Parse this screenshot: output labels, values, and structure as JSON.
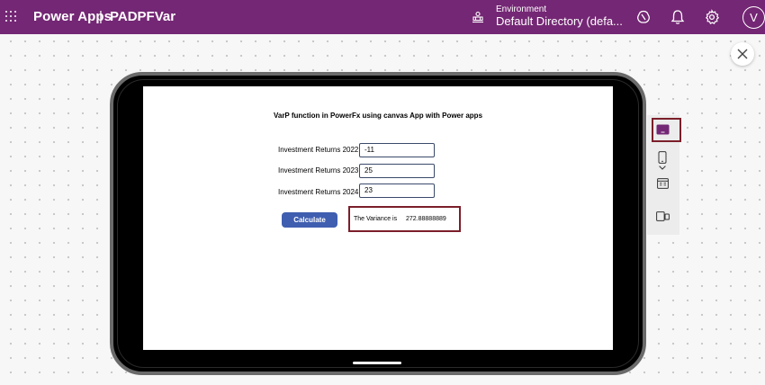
{
  "header": {
    "app_name": "Power Apps",
    "separator": "|",
    "file_name": "PADPFVar",
    "environment_label": "Environment",
    "environment_value": "Default Directory (defa...",
    "user_initial": "V"
  },
  "app": {
    "title": "VarP function in PowerFx using canvas App with Power apps",
    "fields": [
      {
        "label": "Investment Returns 2022",
        "value": "-11"
      },
      {
        "label": "Investment Returns 2023",
        "value": "25"
      },
      {
        "label": "Investment Returns 2024",
        "value": "23"
      }
    ],
    "calculate_label": "Calculate",
    "result_label": "The Variance is",
    "result_value": "272.88888889"
  },
  "colors": {
    "brand": "#742774",
    "button": "#3f5eb0",
    "highlight": "#7b1f2a"
  },
  "icons": [
    "waffle-icon",
    "environment-icon",
    "copilot-icon",
    "bell-icon",
    "gear-icon",
    "close-icon",
    "tablet-icon",
    "phone-icon",
    "chevron-down-icon",
    "web-icon",
    "device-settings-icon"
  ]
}
